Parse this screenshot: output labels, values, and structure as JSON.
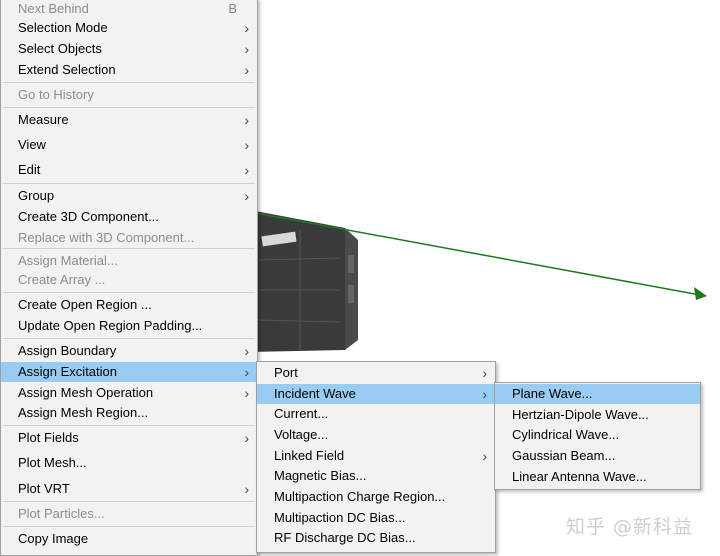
{
  "main_menu": {
    "items": [
      {
        "label": "Next Behind",
        "shortcut": "B",
        "disabled": true
      },
      {
        "label": "Selection Mode",
        "arrow": "›"
      },
      {
        "label": "Select Objects",
        "arrow": "›"
      },
      {
        "label": "Extend Selection",
        "arrow": "›"
      },
      {
        "label": "Go to History",
        "disabled": true
      },
      {
        "label": "Measure",
        "arrow": "›"
      },
      {
        "label": "View",
        "arrow": "›"
      },
      {
        "label": "Edit",
        "arrow": "›"
      },
      {
        "label": "Group",
        "arrow": "›"
      },
      {
        "label": "Create 3D Component..."
      },
      {
        "label": "Replace with 3D Component...",
        "disabled": true
      },
      {
        "label": "Assign Material...",
        "disabled": true
      },
      {
        "label": "Create Array ...",
        "disabled": true
      },
      {
        "label": "Create Open Region ..."
      },
      {
        "label": "Update Open Region Padding..."
      },
      {
        "label": "Assign Boundary",
        "arrow": "›"
      },
      {
        "label": "Assign Excitation",
        "arrow": "›",
        "highlighted": true
      },
      {
        "label": "Assign Mesh Operation",
        "arrow": "›"
      },
      {
        "label": "Assign Mesh Region..."
      },
      {
        "label": "Plot Fields",
        "arrow": "›"
      },
      {
        "label": "Plot Mesh..."
      },
      {
        "label": "Plot VRT",
        "arrow": "›"
      },
      {
        "label": "Plot Particles...",
        "disabled": true
      },
      {
        "label": "Copy Image"
      }
    ]
  },
  "excitation_menu": {
    "items": [
      {
        "label": "Port",
        "arrow": "›"
      },
      {
        "label": "Incident Wave",
        "arrow": "›",
        "highlighted": true
      },
      {
        "label": "Current..."
      },
      {
        "label": "Voltage..."
      },
      {
        "label": "Linked Field",
        "arrow": "›"
      },
      {
        "label": "Magnetic Bias..."
      },
      {
        "label": "Multipaction Charge Region..."
      },
      {
        "label": "Multipaction DC Bias..."
      },
      {
        "label": "RF Discharge DC Bias..."
      }
    ]
  },
  "incident_wave_menu": {
    "items": [
      {
        "label": "Plane Wave...",
        "highlighted": true
      },
      {
        "label": "Hertzian-Dipole Wave..."
      },
      {
        "label": "Cylindrical Wave..."
      },
      {
        "label": "Gaussian Beam..."
      },
      {
        "label": "Linear Antenna Wave..."
      }
    ]
  },
  "watermark": "知乎 @新科益",
  "colors": {
    "highlight": "#99ccf3",
    "menu_bg": "#f2f2f2",
    "axis": "#1f7a1f",
    "model": "#3a3a3a"
  }
}
